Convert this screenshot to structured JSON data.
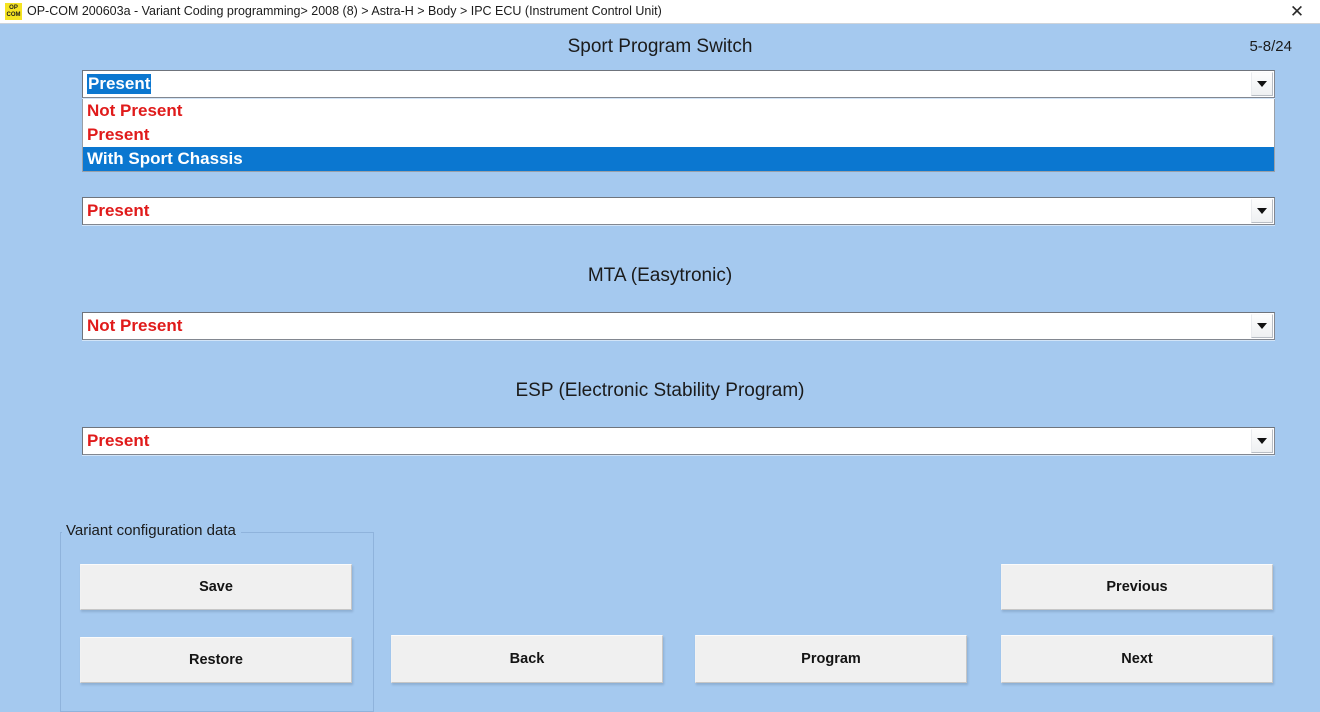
{
  "titlebar": {
    "icon_line1": "OP",
    "icon_line2": "COM",
    "title": "OP-COM 200603a - Variant Coding programming> 2008 (8) > Astra-H > Body > IPC ECU (Instrument Control Unit)",
    "close_label": "✕"
  },
  "page": {
    "indicator": "5-8/24",
    "accent_blue": "#0b77d0",
    "background": "#a5c9ef",
    "value_red": "#e01b1b"
  },
  "sections": [
    {
      "title": "Sport Program Switch",
      "combo": {
        "value": "Present",
        "options": [
          {
            "label": "Not Present",
            "highlighted": false
          },
          {
            "label": "Present",
            "highlighted": false
          },
          {
            "label": "With Sport Chassis",
            "highlighted": true
          }
        ]
      }
    },
    {
      "title": "",
      "combo": {
        "value": "Present",
        "options": []
      }
    },
    {
      "title": "MTA (Easytronic)",
      "combo": {
        "value": "Not Present",
        "options": []
      }
    },
    {
      "title": "ESP (Electronic Stability Program)",
      "combo": {
        "value": "Present",
        "options": []
      }
    }
  ],
  "groupbox": {
    "label": "Variant configuration data",
    "save_label": "Save",
    "restore_label": "Restore"
  },
  "actions": {
    "back_label": "Back",
    "program_label": "Program",
    "previous_label": "Previous",
    "next_label": "Next"
  }
}
